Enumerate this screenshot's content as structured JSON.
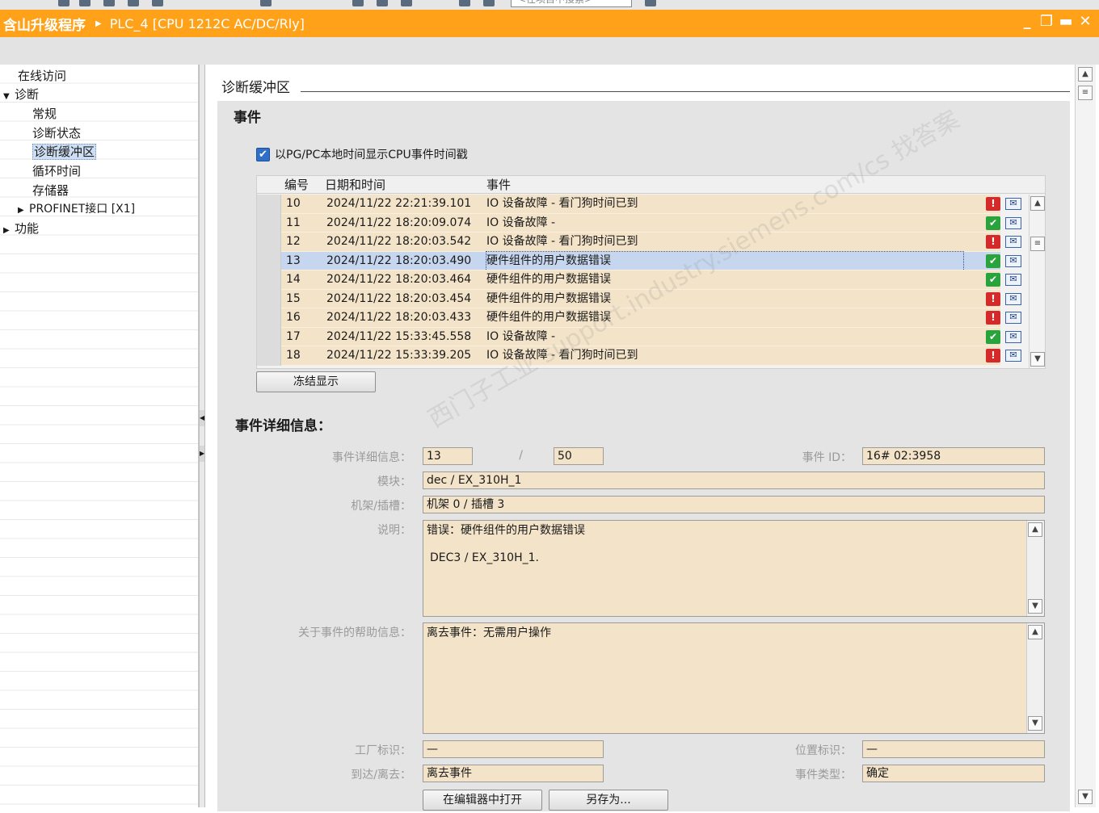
{
  "toolbar": {
    "search_placeholder": "<在项目中搜索>"
  },
  "titlebar": {
    "project": "含山升级程序",
    "plc": "PLC_4 [CPU 1212C AC/DC/Rly]",
    "arrow": "▶"
  },
  "window_controls": {
    "minimize": "_",
    "restore": "❐",
    "maximize": "▬",
    "close": "✕"
  },
  "sidebar": {
    "items": [
      {
        "label": "在线访问",
        "tri": ""
      },
      {
        "label": "诊断",
        "tri": "▼"
      },
      {
        "label": "常规",
        "tri": ""
      },
      {
        "label": "诊断状态",
        "tri": ""
      },
      {
        "label": "诊断缓冲区",
        "tri": ""
      },
      {
        "label": "循环时间",
        "tri": ""
      },
      {
        "label": "存储器",
        "tri": ""
      },
      {
        "label": "PROFINET接口 [X1]",
        "tri": "▶"
      },
      {
        "label": "功能",
        "tri": "▶"
      }
    ]
  },
  "main": {
    "section_title": "诊断缓冲区",
    "events_heading": "事件",
    "checkbox_label": "以PG/PC本地时间显示CPU事件时间戳",
    "checkbox_mark": "✔",
    "table_headers": {
      "num": "编号",
      "datetime": "日期和时间",
      "event": "事件"
    },
    "rows": [
      {
        "num": "10",
        "datetime": "2024/11/22 22:21:39.101",
        "event": "IO 设备故障 - 看门狗时间已到",
        "status": "error"
      },
      {
        "num": "11",
        "datetime": "2024/11/22 18:20:09.074",
        "event": "IO 设备故障 -",
        "status": "ok"
      },
      {
        "num": "12",
        "datetime": "2024/11/22 18:20:03.542",
        "event": "IO 设备故障 - 看门狗时间已到",
        "status": "error"
      },
      {
        "num": "13",
        "datetime": "2024/11/22 18:20:03.490",
        "event": "硬件组件的用户数据错误",
        "status": "ok"
      },
      {
        "num": "14",
        "datetime": "2024/11/22 18:20:03.464",
        "event": "硬件组件的用户数据错误",
        "status": "ok"
      },
      {
        "num": "15",
        "datetime": "2024/11/22 18:20:03.454",
        "event": "硬件组件的用户数据错误",
        "status": "error"
      },
      {
        "num": "16",
        "datetime": "2024/11/22 18:20:03.433",
        "event": "硬件组件的用户数据错误",
        "status": "error"
      },
      {
        "num": "17",
        "datetime": "2024/11/22 15:33:45.558",
        "event": "IO 设备故障 -",
        "status": "ok"
      },
      {
        "num": "18",
        "datetime": "2024/11/22 15:33:39.205",
        "event": "IO 设备故障 - 看门狗时间已到",
        "status": "error"
      }
    ],
    "selected_row": "13",
    "freeze_button": "冻结显示",
    "details_heading": "事件详细信息：",
    "details": {
      "detail_label": "事件详细信息：",
      "detail_index": "13",
      "detail_sep": "/",
      "detail_total": "50",
      "event_id_label": "事件 ID：",
      "event_id": "16# 02:3958",
      "module_label": "模块：",
      "module": "dec / EX_310H_1",
      "rack_label": "机架/插槽：",
      "rack": "机架 0 / 插槽 3",
      "desc_label": "说明：",
      "desc_line1": "错误：硬件组件的用户数据错误",
      "desc_line2": "DEC3 / EX_310H_1.",
      "help_label": "关于事件的帮助信息：",
      "help": "离去事件：无需用户操作",
      "plant_label": "工厂标识：",
      "plant": "—",
      "location_label": "位置标识：",
      "location": "—",
      "arrive_label": "到达/离去：",
      "arrive": "离去事件",
      "type_label": "事件类型：",
      "type": "确定"
    },
    "open_editor_button": "在编辑器中打开",
    "save_as_button": "另存为..."
  },
  "watermark": "西门子工业 support.industry.siemens.com/cs 找答案",
  "colors": {
    "title_orange": "#ffa21a",
    "field_beige": "#f3e3c8",
    "selected_row": "#c6d6ee",
    "error_red": "#d42a2a",
    "ok_green": "#29a33b"
  }
}
